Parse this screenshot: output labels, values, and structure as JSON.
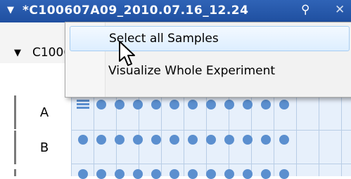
{
  "window": {
    "title": "*C100607A09_2010.07.16_12.24",
    "collapse_icon": "triangle-down",
    "pin_icon": "pin",
    "close_icon": "x"
  },
  "subheader": {
    "label": "C100607A09_2010.07.16_12.24",
    "collapse_icon": "triangle-down"
  },
  "context_menu": {
    "items": [
      {
        "label": "Select all Samples",
        "highlighted": true
      },
      {
        "label": "Visualize Whole Experiment",
        "highlighted": false
      }
    ]
  },
  "plate": {
    "rows": [
      "A",
      "B"
    ],
    "well_color": "#5b8fcf",
    "grid_color": "#b8cde6"
  },
  "colors": {
    "titlebar": "#2f63b6",
    "menu_highlight": "#ddeeff"
  }
}
